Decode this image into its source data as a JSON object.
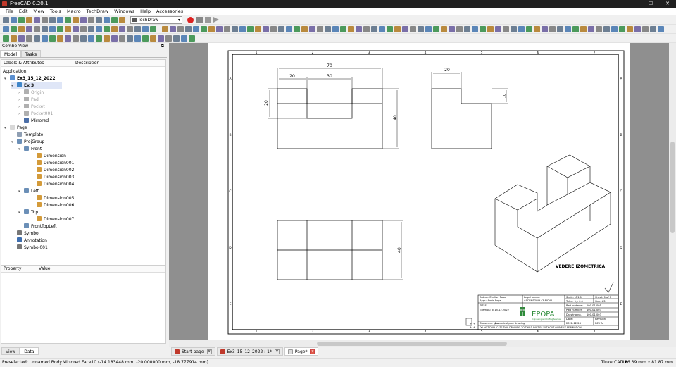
{
  "window": {
    "title": "FreeCAD 0.20.1",
    "controls": [
      "—",
      "☐",
      "✕"
    ]
  },
  "menu": [
    "File",
    "Edit",
    "View",
    "Tools",
    "Macro",
    "TechDraw",
    "Windows",
    "Help",
    "Accessories"
  ],
  "toolbar": {
    "workbench": "TechDraw"
  },
  "combo": {
    "title": "Combo View",
    "undock": "⧉",
    "tabs": [
      "Model",
      "Tasks"
    ],
    "tree_headers": [
      "Labels & Attributes",
      "Description"
    ],
    "application": "Application",
    "tree": [
      {
        "label": "Ex3_15_12_2022",
        "arrow": "▾",
        "level": 1,
        "icon": "#5a8fd0",
        "bold": true
      },
      {
        "label": "Ex 3",
        "arrow": "▾",
        "level": 2,
        "icon": "#3f86c9",
        "bold": true,
        "selected": true
      },
      {
        "label": "Origin",
        "arrow": "›",
        "level": 3,
        "icon": "#b0b0b0",
        "dim": true
      },
      {
        "label": "Pad",
        "arrow": "›",
        "level": 3,
        "icon": "#b0b0b0",
        "dim": true
      },
      {
        "label": "Pocket",
        "arrow": "›",
        "level": 3,
        "icon": "#b0b0b0",
        "dim": true
      },
      {
        "label": "Pocket001",
        "arrow": "›",
        "level": 3,
        "icon": "#b0b0b0",
        "dim": true
      },
      {
        "label": "Mirrored",
        "arrow": "",
        "level": 3,
        "icon": "#4c6fa8"
      },
      {
        "label": "Page",
        "arrow": "▾",
        "level": 1,
        "icon": "#d8d8d8"
      },
      {
        "label": "Template",
        "arrow": "",
        "level": 2,
        "icon": "#8f9fb3"
      },
      {
        "label": "ProjGroup",
        "arrow": "▾",
        "level": 2,
        "icon": "#6b8fb7"
      },
      {
        "label": "Front",
        "arrow": "▾",
        "level": 3,
        "icon": "#6b8fb7"
      },
      {
        "label": "Dimension",
        "arrow": "",
        "level": 4,
        "icon": "#d49b3a"
      },
      {
        "label": "Dimension001",
        "arrow": "",
        "level": 4,
        "icon": "#d49b3a"
      },
      {
        "label": "Dimension002",
        "arrow": "",
        "level": 4,
        "icon": "#d49b3a"
      },
      {
        "label": "Dimension003",
        "arrow": "",
        "level": 4,
        "icon": "#d49b3a"
      },
      {
        "label": "Dimension004",
        "arrow": "",
        "level": 4,
        "icon": "#d49b3a"
      },
      {
        "label": "Left",
        "arrow": "▾",
        "level": 3,
        "icon": "#6b8fb7"
      },
      {
        "label": "Dimension005",
        "arrow": "",
        "level": 4,
        "icon": "#d49b3a"
      },
      {
        "label": "Dimension006",
        "arrow": "",
        "level": 4,
        "icon": "#d49b3a"
      },
      {
        "label": "Top",
        "arrow": "▾",
        "level": 3,
        "icon": "#6b8fb7"
      },
      {
        "label": "Dimension007",
        "arrow": "",
        "level": 4,
        "icon": "#d49b3a"
      },
      {
        "label": "FrontTopLeft",
        "arrow": "",
        "level": 3,
        "icon": "#6b8fb7"
      },
      {
        "label": "Symbol",
        "arrow": "",
        "level": 2,
        "icon": "#777"
      },
      {
        "label": "Annotation",
        "arrow": "",
        "level": 2,
        "icon": "#3f6fb0"
      },
      {
        "label": "Symbol001",
        "arrow": "",
        "level": 2,
        "icon": "#777"
      }
    ],
    "prop_headers": [
      "Property",
      "Value"
    ],
    "bottom_tabs": [
      "View",
      "Data"
    ]
  },
  "drawing": {
    "column_numbers": [
      "1",
      "2",
      "3",
      "4",
      "5",
      "6",
      "7"
    ],
    "row_letters": [
      "A",
      "B",
      "C",
      "D",
      "E"
    ],
    "dims": {
      "d70": "70",
      "d20a": "20",
      "d30": "30",
      "d20b": "20",
      "d40a": "40",
      "d20c": "20",
      "d10": "10",
      "d40b": "40"
    },
    "iso_label": "VEDERE IZOMETRICA",
    "title_block": {
      "author": "Author: Emilian Popa",
      "appr": "Appr.:    Sorin Popa",
      "legal": "Legal owner:",
      "legal_value": "ASCENSORIX CRAIOVA",
      "scale": "Scale: M 1:1",
      "sheet": "Sheet: 1 of 1",
      "toler": "Toler.: +/- 0.1",
      "size": "Size:    A3",
      "title_label": "TITLE:",
      "title_value": "Exemplu 3/ 15.12.2022",
      "logo": "EPOPA",
      "logo_sub": "Engineering and Drafting Services",
      "part_material": "Part material:",
      "part_material_value": "100-01-001",
      "part_number": "Part number:",
      "part_number_value": "100-01-003",
      "drawing_no": "Drawing no.:",
      "drawing_no_value": "100-01-003",
      "date": "Date:",
      "date_value": "2022-12-28",
      "revision": "Revision:",
      "revision_value": "REV A",
      "doc_type": "Document type:",
      "doc_type_value": "Mechanical part drawing",
      "warning": "DO NOT DUPLICATE THIS DRAWING TO THIRD PARTIES WITHOUT OWNER'S PERMISSION!"
    }
  },
  "mdi_tabs": [
    {
      "label": "Start page"
    },
    {
      "label": "Ex3_15_12_2022 : 1*"
    },
    {
      "label": "Page*"
    }
  ],
  "status": {
    "message": "Preselected: Unnamed.Body.Mirrored.Face10 (-14.183448 mm, -20.000000 mm, -18.777914 mm)",
    "nav": "TinkerCAD ▾",
    "dims": "136.39 mm x 81.87 mm"
  }
}
